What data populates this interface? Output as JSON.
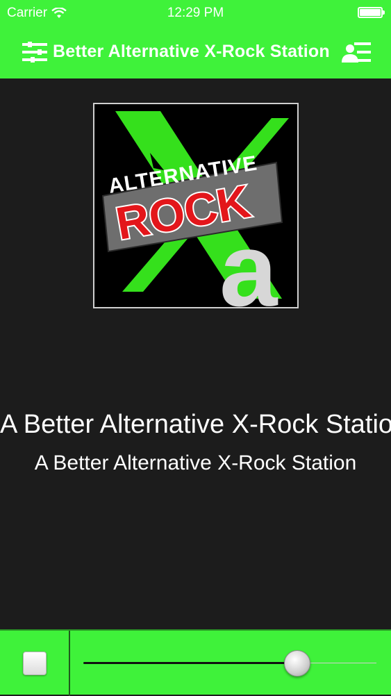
{
  "status_bar": {
    "carrier": "Carrier",
    "time": "12:29 PM"
  },
  "nav": {
    "title": "Better Alternative X-Rock Station"
  },
  "artwork": {
    "logo_text_top": "ALTERNATIVE",
    "logo_text_main": "ROCK",
    "logo_letter": "a",
    "colors": {
      "x": "#35e01c",
      "rock": "#e3161b"
    }
  },
  "now_playing": {
    "title": "A Better Alternative X-Rock Station",
    "subtitle": "A Better Alternative X-Rock Station"
  },
  "player": {
    "volume": 0.73
  },
  "colors": {
    "accent": "#3ff23a",
    "background": "#1c1c1c"
  }
}
